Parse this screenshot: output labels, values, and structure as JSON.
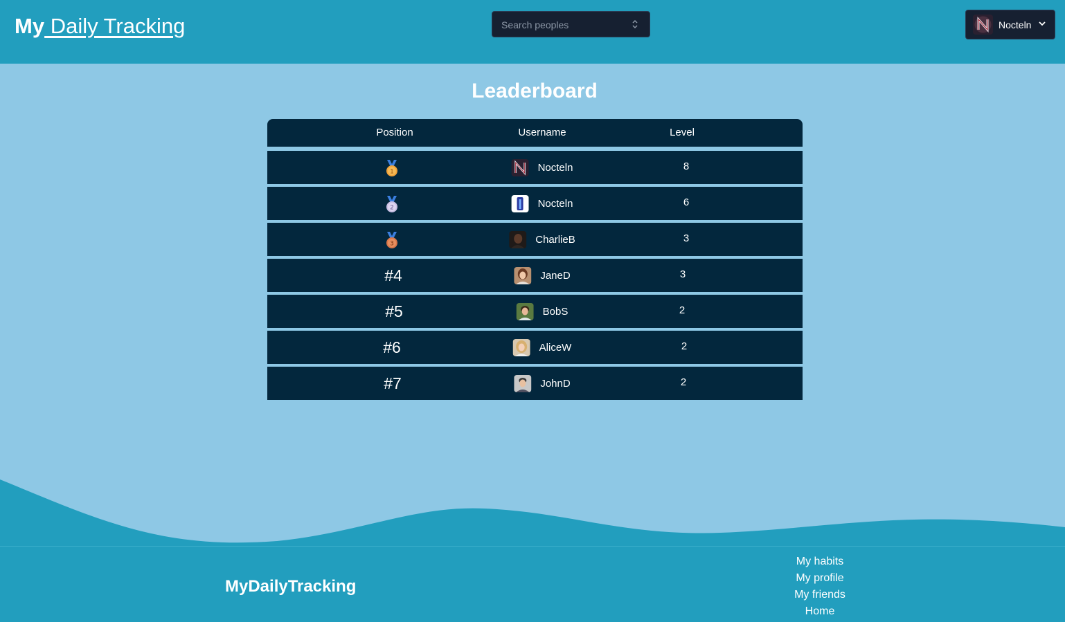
{
  "header": {
    "brand_bold": "My",
    "brand_rest": " Daily Tracking",
    "search": {
      "placeholder": "Search peoples"
    },
    "user": {
      "name": "Nocteln"
    }
  },
  "page": {
    "title": "Leaderboard"
  },
  "table": {
    "headers": {
      "position": "Position",
      "username": "Username",
      "level": "Level"
    },
    "rows": [
      {
        "rank": "1",
        "medal": "gold",
        "username": "Nocteln",
        "level": "8"
      },
      {
        "rank": "2",
        "medal": "silver",
        "username": "Nocteln",
        "level": "6"
      },
      {
        "rank": "3",
        "medal": "bronze",
        "username": "CharlieB",
        "level": "3"
      },
      {
        "rank": "#4",
        "username": "JaneD",
        "level": "3"
      },
      {
        "rank": "#5",
        "username": "BobS",
        "level": "2"
      },
      {
        "rank": "#6",
        "username": "AliceW",
        "level": "2"
      },
      {
        "rank": "#7",
        "username": "JohnD",
        "level": "2"
      }
    ]
  },
  "footer": {
    "brand": "MyDailyTracking",
    "links": [
      "My habits",
      "My profile",
      "My friends",
      "Home"
    ]
  },
  "colors": {
    "header_bg": "#229ebe",
    "page_bg": "#8ec8e5",
    "table_bg": "#03273d",
    "input_bg": "#162031"
  }
}
